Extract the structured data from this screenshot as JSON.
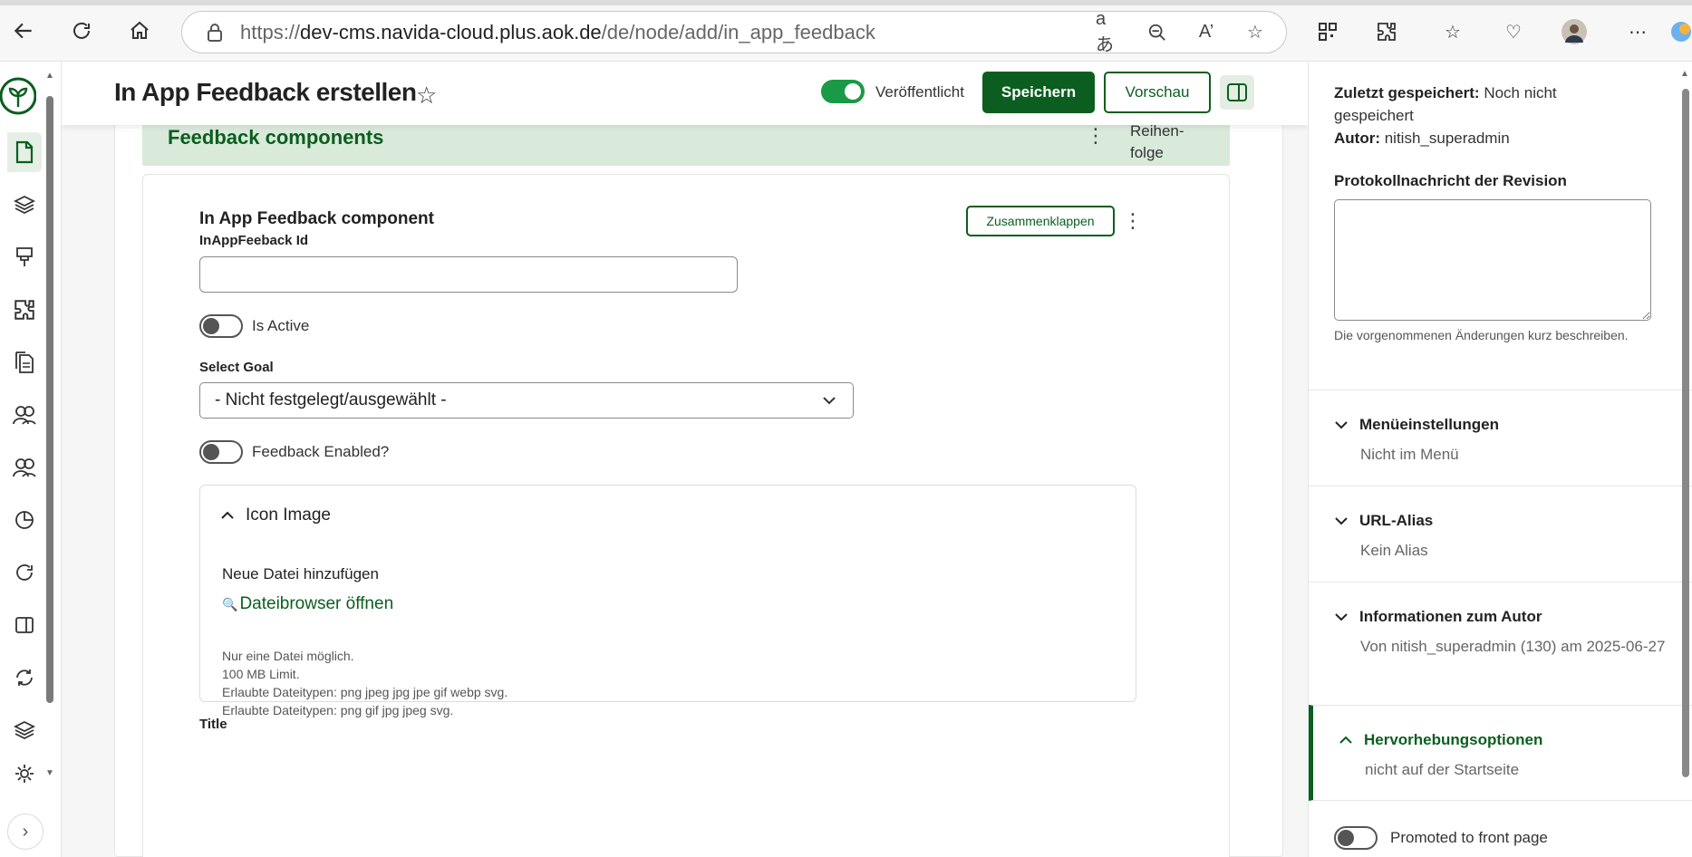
{
  "browser": {
    "url_scheme": "https://",
    "url_host": "dev-cms.navida-cloud.plus.aok.de",
    "url_path": "/de/node/add/in_app_feedback"
  },
  "header": {
    "title": "In App Feedback erstellen",
    "published_label": "Veröffentlicht",
    "published": true,
    "save_label": "Speichern",
    "preview_label": "Vorschau"
  },
  "feedback_components": {
    "title": "Feedback components",
    "order_label_1": "Reihen-",
    "order_label_2": "folge"
  },
  "component": {
    "title": "In App Feedback component",
    "collapse_label": "Zusammenklappen",
    "id_label": "InAppFeeback Id",
    "id_value": "",
    "is_active_label": "Is Active",
    "is_active": false,
    "goal_label": "Select Goal",
    "goal_value": "- Nicht festgelegt/ausgewählt -",
    "feedback_enabled_label": "Feedback Enabled?",
    "feedback_enabled": false,
    "icon_image": {
      "title": "Icon Image",
      "add_file_label": "Neue Datei hinzufügen",
      "browser_link": "Dateibrowser öffnen",
      "help_1": "Nur eine Datei möglich.",
      "help_2": "100 MB Limit.",
      "help_3": "Erlaubte Dateitypen: png jpeg jpg jpe gif webp svg.",
      "help_4": "Erlaubte Dateitypen: png gif jpg jpeg svg."
    },
    "title_label": "Title"
  },
  "sidebar": {
    "last_saved_key": "Zuletzt gespeichert:",
    "last_saved_value": "Noch nicht gespeichert",
    "author_key": "Autor:",
    "author_value": "nitish_superadmin",
    "revision_label": "Protokollnachricht der Revision",
    "revision_help": "Die vorgenommenen Änderungen kurz beschreiben.",
    "sections": [
      {
        "title": "Menüeinstellungen",
        "subtitle": "Nicht im Menü"
      },
      {
        "title": "URL-Alias",
        "subtitle": "Kein Alias"
      },
      {
        "title": "Informationen zum Autor",
        "subtitle": "Von nitish_superadmin (130) am 2025-06-27"
      },
      {
        "title": "Hervorhebungsoptionen",
        "subtitle": "nicht auf der Startseite"
      }
    ],
    "promoted_label": "Promoted to front page"
  },
  "colors": {
    "brand_green": "#0b5e1f",
    "toggle_green": "#1a9a44",
    "panel_green": "#d9eadb"
  }
}
